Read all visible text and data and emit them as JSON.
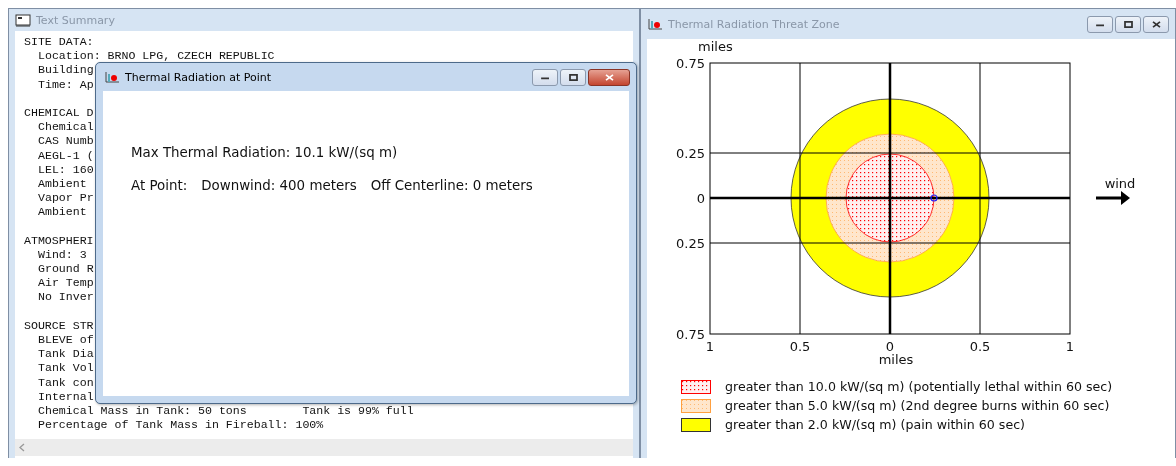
{
  "text_summary": {
    "title": "Text Summary",
    "lines": [
      {
        "kind": "heading",
        "text": "SITE DATA:"
      },
      {
        "kind": "item",
        "text": "Location: BRNO LPG, CZECH REPUBLIC"
      },
      {
        "kind": "item",
        "text": "Building"
      },
      {
        "kind": "item",
        "text": "Time: Ap"
      },
      {
        "kind": "heading",
        "text": "CHEMICAL D"
      },
      {
        "kind": "item",
        "text": "Chemical"
      },
      {
        "kind": "item",
        "text": "CAS Numb"
      },
      {
        "kind": "item",
        "text": "AEGL-1 ("
      },
      {
        "kind": "item",
        "text": "LEL: 160"
      },
      {
        "kind": "item",
        "text": "Ambient"
      },
      {
        "kind": "item",
        "text": "Vapor Pr"
      },
      {
        "kind": "item",
        "text": "Ambient"
      },
      {
        "kind": "heading",
        "text": "ATMOSPHERI"
      },
      {
        "kind": "item",
        "text": "Wind: 3"
      },
      {
        "kind": "item",
        "text": "Ground R"
      },
      {
        "kind": "item",
        "text": "Air Temp"
      },
      {
        "kind": "item",
        "text": "No Inver"
      },
      {
        "kind": "heading",
        "text": "SOURCE STR"
      },
      {
        "kind": "item",
        "text": "BLEVE of"
      },
      {
        "kind": "item",
        "text": "Tank Dia"
      },
      {
        "kind": "item",
        "text": "Tank Vol"
      },
      {
        "kind": "item",
        "text": "Tank con"
      },
      {
        "kind": "item",
        "text": "Internal"
      },
      {
        "kind": "item",
        "text": "Chemical Mass in Tank: 50 tons        Tank is 99% full"
      },
      {
        "kind": "item",
        "text": "Percentage of Tank Mass in Fireball: 100%"
      }
    ]
  },
  "point_dialog": {
    "title": "Thermal Radiation at Point",
    "lines": [
      {
        "parts": [
          "Max Thermal Radiation: 10.1 kW/(sq m)"
        ]
      },
      {
        "parts": [
          "At Point:",
          "Downwind: 400 meters",
          "Off Centerline: 0 meters"
        ]
      }
    ]
  },
  "threat_zone": {
    "title": "Thermal Radiation Threat Zone",
    "plot": {
      "y_unit": "miles",
      "y_ticks": [
        "0.75",
        "0.25",
        "0",
        "0.25",
        "0.75"
      ],
      "x_ticks": [
        "1",
        "0.5",
        "0",
        "0.5",
        "1"
      ],
      "x_unit": "miles",
      "wind_label": "wind"
    },
    "legend": [
      {
        "label": "greater than 10.0 kW/(sq m) (potentially lethal within 60 sec)",
        "color": "#ff0000",
        "kind": "dots"
      },
      {
        "label": "greater than 5.0 kW/(sq m) (2nd degree burns within 60 sec)",
        "color": "#ffa040",
        "kind": "fine-dots"
      },
      {
        "label": "greater than 2.0 kW/(sq m) (pain within 60 sec)",
        "color": "#ffff00",
        "kind": "solid"
      }
    ]
  }
}
